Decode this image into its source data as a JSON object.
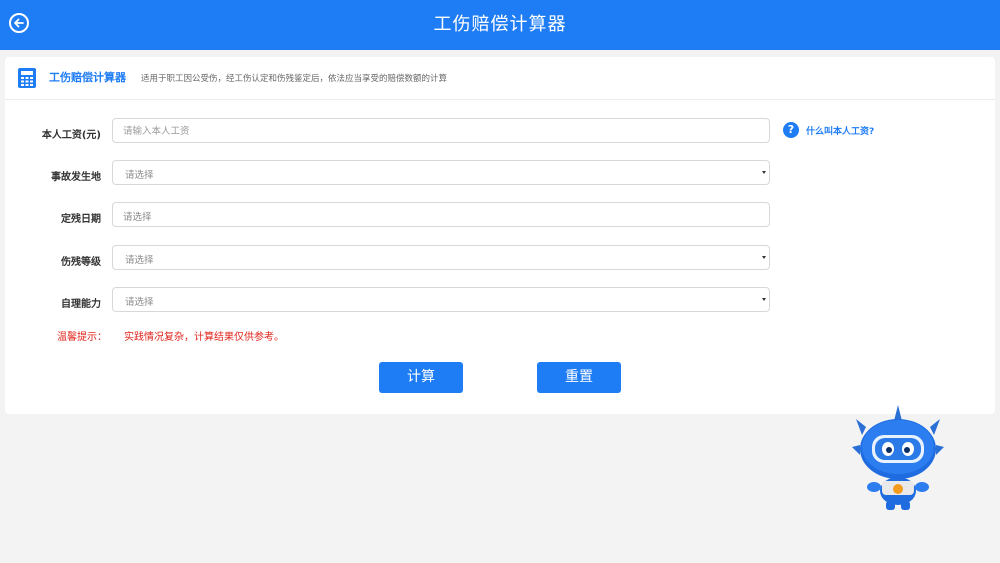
{
  "header": {
    "title": "工伤赔偿计算器",
    "back_icon": "back-arrow-icon"
  },
  "card": {
    "title": "工伤赔偿计算器",
    "description": "适用于职工因公受伤，经工伤认定和伤残鉴定后，依法应当享受的赔偿数额的计算",
    "icon": "calculator-icon"
  },
  "form": {
    "salary": {
      "label": "本人工资(元)",
      "placeholder": "请输入本人工资",
      "value": ""
    },
    "location": {
      "label": "事故发生地",
      "placeholder": "请选择"
    },
    "date": {
      "label": "定残日期",
      "placeholder": "请选择"
    },
    "grade": {
      "label": "伤残等级",
      "placeholder": "请选择"
    },
    "ability": {
      "label": "自理能力",
      "placeholder": "请选择"
    }
  },
  "help": {
    "icon_text": "?",
    "link": "什么叫本人工资?"
  },
  "tip": {
    "label": "温馨提示：",
    "text": "实践情况复杂，计算结果仅供参考。"
  },
  "buttons": {
    "calculate": "计算",
    "reset": "重置"
  },
  "colors": {
    "primary": "#1e7cf4",
    "warning": "#e0241b",
    "background": "#f3f3f3"
  },
  "mascot": "blue-robot-mascot"
}
